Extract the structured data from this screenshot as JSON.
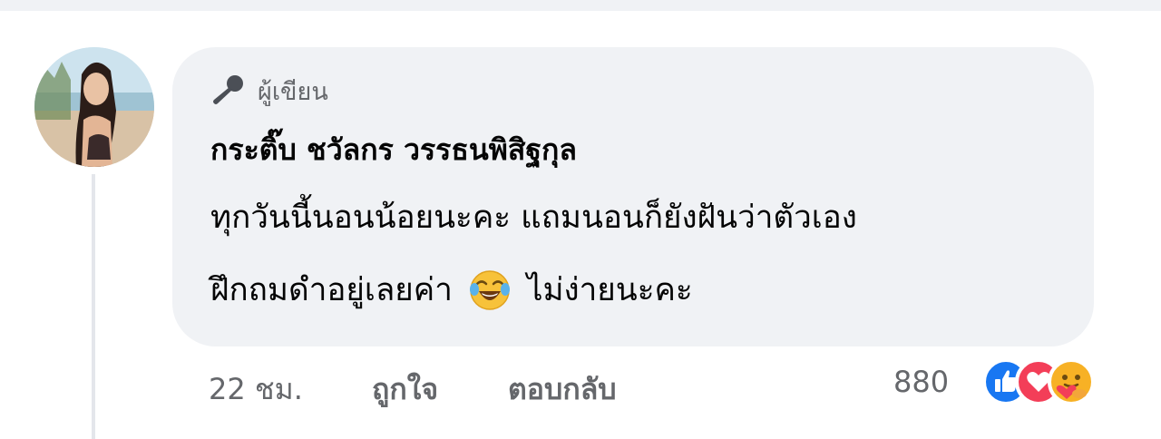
{
  "comment": {
    "badge": {
      "icon": "microphone-icon",
      "label": "ผู้เขียน"
    },
    "author": "กระติ๊บ ชวัลกร วรรธนพิสิฐกุล",
    "text_line1": "ทุกวันนี้นอนน้อยนะคะ แถมนอนก็ยังฝันว่าตัวเอง",
    "text_line2_before": "ฝึกถมดำอยู่เลยค่า",
    "emoji": "face-with-tears-of-joy-icon",
    "text_line2_after": "ไม่ง่ายนะคะ"
  },
  "actions": {
    "time": "22 ชม.",
    "like": "ถูกใจ",
    "reply": "ตอบกลับ"
  },
  "reactions": {
    "count": "880",
    "icons": [
      "like-reaction-icon",
      "love-reaction-icon",
      "care-reaction-icon"
    ],
    "colors": {
      "like": "#1877f2",
      "love": "#f33e58",
      "care": "#f7b125"
    }
  }
}
